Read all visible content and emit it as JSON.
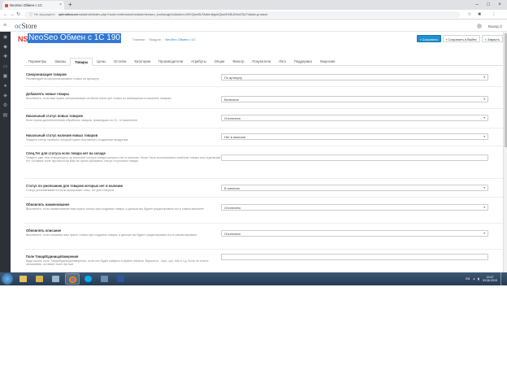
{
  "browser": {
    "tab_title": "NeoSeo Обмен с 1С",
    "tab_close": "×",
    "new_tab": "+",
    "insecure_label": "Не защищено",
    "url_host": "optmattracom.ru",
    "url_path": "/admin/index.php?route=extension/module/neoseo_exchange1c&token=WVQew3sTAdem6gvbQweE4BUDhdZ3LFn#tab-product",
    "window_controls": [
      "–",
      "□",
      "×"
    ]
  },
  "admin": {
    "logo_prefix": "oc",
    "logo_suffix": "Store",
    "logout_label": "Выход",
    "sidebar_icons": [
      "dashboard-icon",
      "catalog-icon",
      "extensions-icon",
      "design-icon",
      "sales-icon",
      "customers-icon",
      "marketing-icon",
      "system-icon",
      "reports-icon"
    ]
  },
  "page": {
    "badge": "NS",
    "title": "NeoSeo Обмен с 1С 190",
    "breadcrumb": [
      "Главная",
      "Модули",
      "NeoSeo Обмен с 1С"
    ],
    "buttons": {
      "save": "Сохранить",
      "save_close": "Сохранить и Выйти",
      "close": "Закрыть"
    },
    "tabs": [
      "Параметры",
      "Заказы",
      "Товары",
      "Цены",
      "Остатки",
      "Категории",
      "Производители",
      "Атрибуты",
      "Опции",
      "Фильтр",
      "Покупатели",
      "Лого",
      "Поддержка",
      "Лицензия"
    ],
    "active_tab": "Товары",
    "fields": [
      {
        "name": "Синхронизация товаров",
        "help": "Рекомендуется синхронизировать только по артикулу",
        "control": "select",
        "value": "По артикулу"
      },
      {
        "name": "Добавлять новые товары",
        "help": "Выключите, если вам нужна синхронизация остатков и/или цен только по имеющимся в магазине товарам",
        "control": "select",
        "value": "Включено"
      },
      {
        "name": "Начальный статус новых товаров",
        "help": "Если нужна дополнительная обработка товаров, пришедших из 1С, то выключите",
        "control": "select",
        "value": "Отключено"
      },
      {
        "name": "Начальный статус наличия новых товаров",
        "help": "Укажите статус наличия, который нужно выставлять созданным продуктам",
        "control": "select",
        "value": "Нет в наличии"
      },
      {
        "name": "Спец.Тег для статуса если товара нет на складе",
        "help": "Укажите имя тега отвечающего за значение статуса товара которого нет в наличии. Могут быть использованы свойства товара или отдельный тег. Оставьте поле пустым если Вам не нужно указывать статус отсутствия товара",
        "control": "input",
        "value": ""
      },
      {
        "name": "Статус по умолчанию для товаров которых нет в наличии",
        "help": "Статус устанавливается если пропускают спец. тег для статусов",
        "control": "select",
        "value": "В наличии"
      },
      {
        "name": "Обновлять наименование",
        "help": "Выключите, если наименование вам нужно только при создании товара, а дальше вы будете редактировать его в самом магазине",
        "control": "select",
        "value": "Отключено"
      },
      {
        "name": "Обновлять описание",
        "help": "Выключите, если описание вам нужно только при создании товара, а дальше вы будете редактировать его в самом магазине",
        "control": "select",
        "value": "Отключено"
      },
      {
        "name": "Поле Товар/ЕдиницаИзмерения",
        "help": "Куда писать поле Товар/ЕдиницаИзмерения, если оно будет найдено в файле обмена. Варианты - mpn, upc, ean и т.д. Если не хотите записывать, оставьте поле пустым",
        "control": "input",
        "value": ""
      }
    ]
  },
  "taskbar": {
    "lang": "EN",
    "time": "13:47",
    "date": "03.06.2019"
  }
}
